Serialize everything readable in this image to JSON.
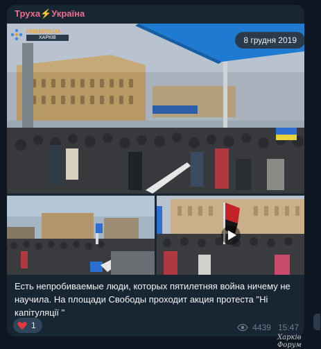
{
  "message": {
    "sender": "Труха⚡Україна",
    "date": "8 грудня 2019",
    "caption": "Есть непробиваемые люди, которых пятилетняя война ничему не научила. На площади Свободы проходит акция протеста \"Ні капітуляції \"",
    "reaction": {
      "emoji": "heart",
      "count": "1"
    },
    "views": "4439",
    "time": "15:47"
  },
  "media": {
    "main": {
      "logo_text": "KHARKIV.UA",
      "city_label": "ХАРКІВ"
    },
    "bottom_left": {},
    "bottom_right": {
      "play_icon": "play-icon"
    }
  },
  "watermark": "Харків Форум",
  "colors": {
    "background": "#0e1621",
    "bubble": "#182533",
    "sender": "#ee6f8c"
  }
}
